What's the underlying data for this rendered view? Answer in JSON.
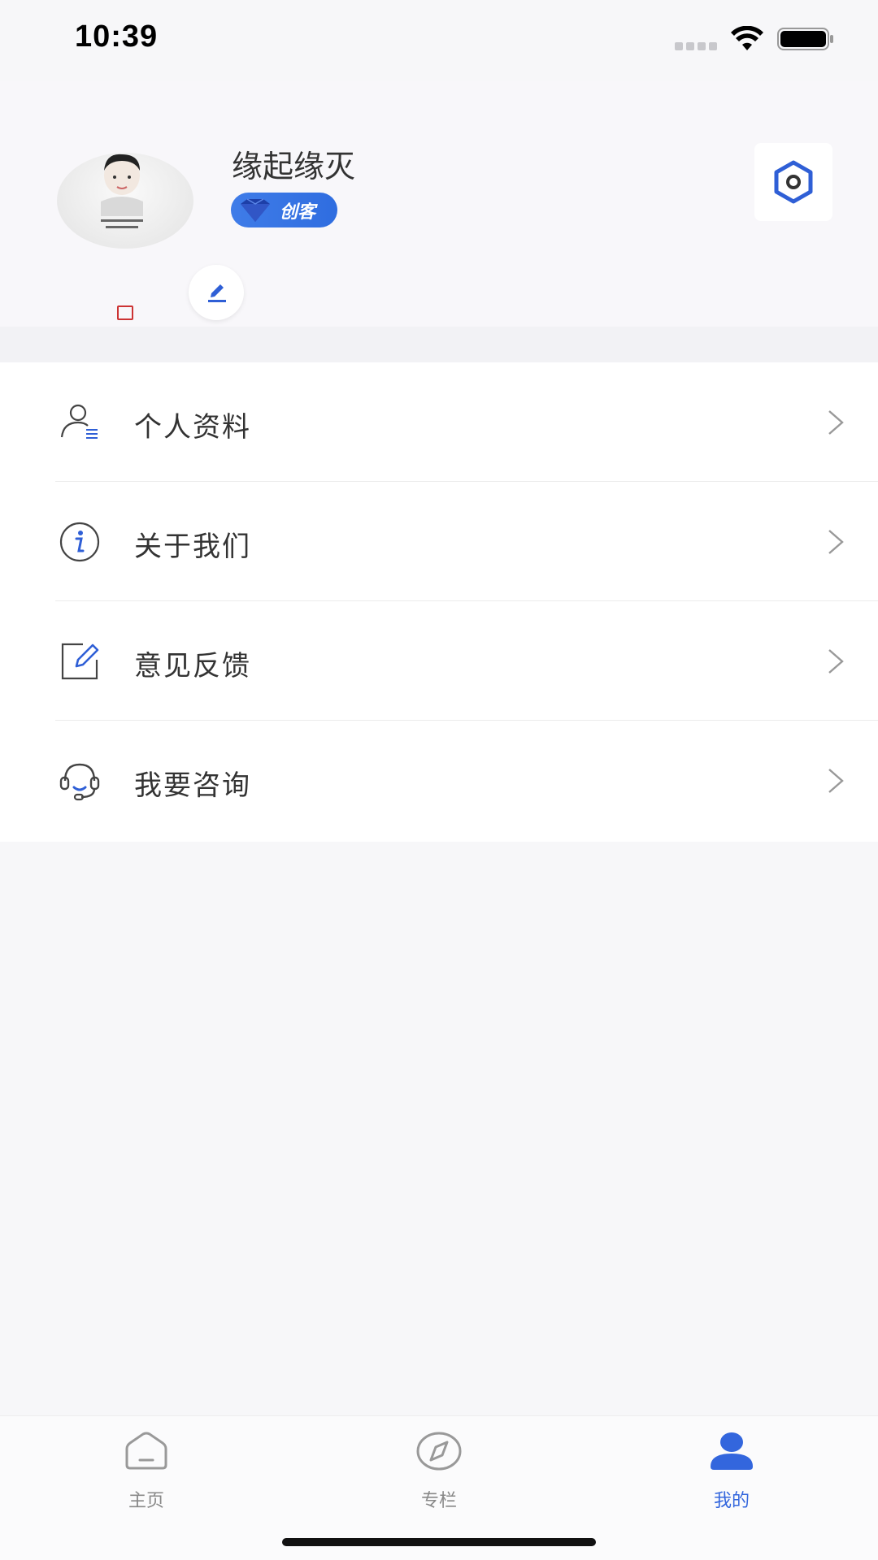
{
  "status_bar": {
    "time": "10:39"
  },
  "profile": {
    "username": "缘起缘灭",
    "badge_label": "创客",
    "avatar_icon": "person-photo",
    "edit_icon": "pencil-icon",
    "settings_icon": "hexagon-settings-icon"
  },
  "menu": {
    "items": [
      {
        "label": "个人资料",
        "icon": "user-profile-icon"
      },
      {
        "label": "关于我们",
        "icon": "info-icon"
      },
      {
        "label": "意见反馈",
        "icon": "feedback-edit-icon"
      },
      {
        "label": "我要咨询",
        "icon": "headset-icon"
      }
    ]
  },
  "tab_bar": {
    "tabs": [
      {
        "label": "主页",
        "icon": "home-icon",
        "active": false
      },
      {
        "label": "专栏",
        "icon": "compass-icon",
        "active": false
      },
      {
        "label": "我的",
        "icon": "user-icon",
        "active": true
      }
    ]
  },
  "colors": {
    "accent": "#3366dd",
    "text_primary": "#333333",
    "text_secondary": "#888888",
    "background": "#f7f7f9"
  }
}
